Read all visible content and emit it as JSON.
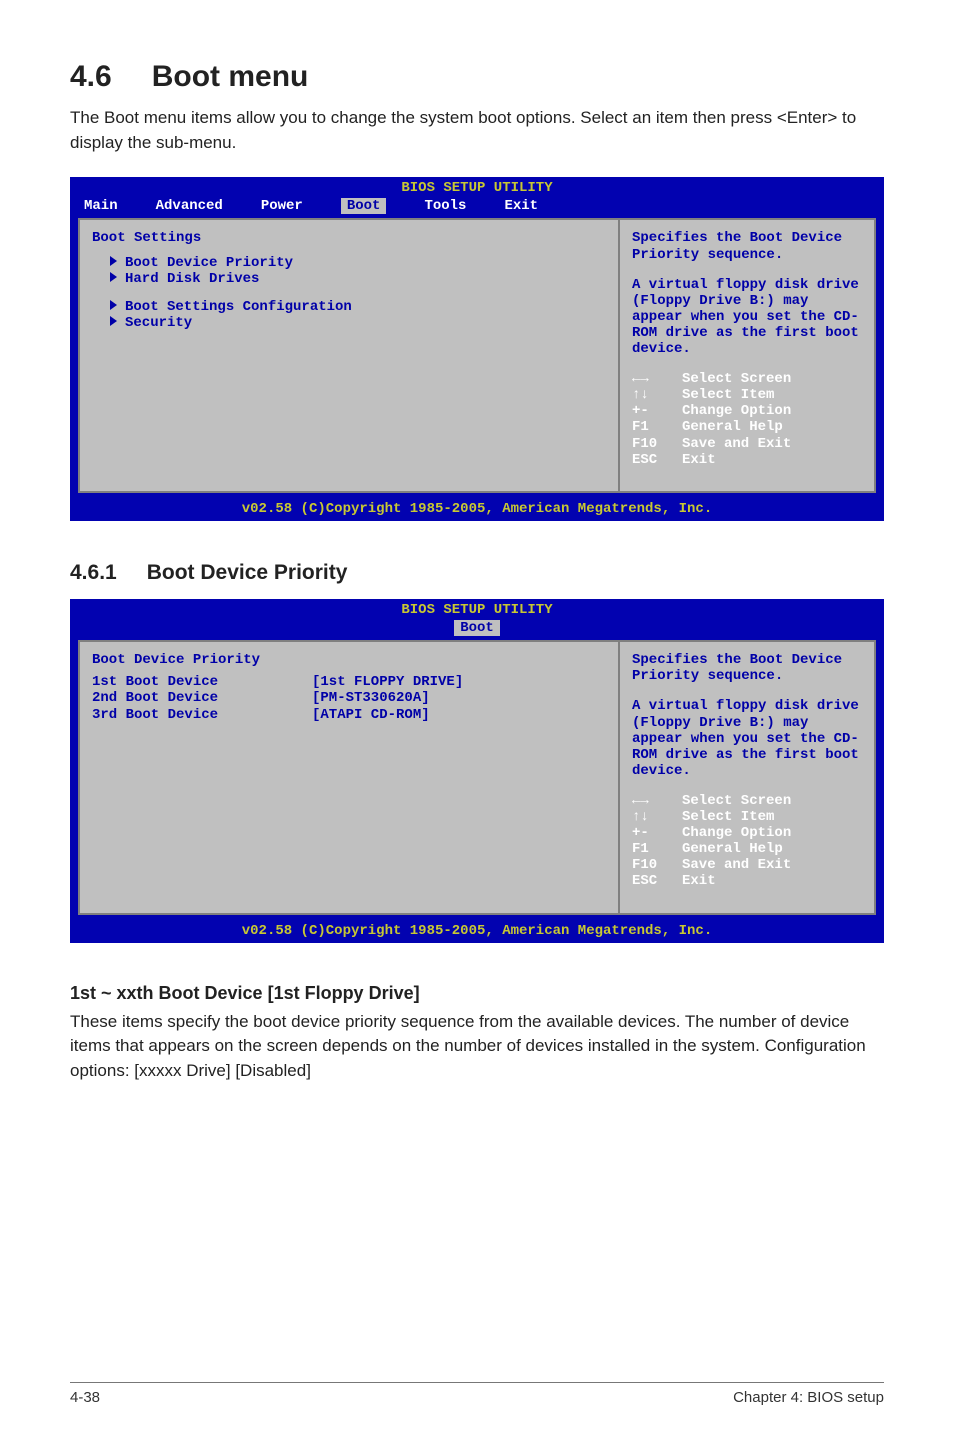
{
  "section": {
    "number": "4.6",
    "title": "Boot menu",
    "intro": "The Boot menu items allow you to change the system boot options. Select an item then press <Enter> to display the sub-menu."
  },
  "bios1": {
    "titlebar": "BIOS SETUP UTILITY",
    "menu": {
      "main": "Main",
      "advanced": "Advanced",
      "power": "Power",
      "boot": "Boot",
      "tools": "Tools",
      "exit": "Exit"
    },
    "left": {
      "heading": "Boot Settings",
      "items": [
        "Boot Device Priority",
        "Hard Disk Drives",
        "Boot Settings Configuration",
        "Security"
      ]
    },
    "right": {
      "desc1": "Specifies the Boot Device Priority sequence.",
      "desc2": "A virtual floppy disk drive (Floppy Drive B:) may appear when you set the CD-ROM drive as the first boot device.",
      "nav": {
        "lr": {
          "key": "←→",
          "label": "Select Screen"
        },
        "ud": {
          "key": "↑↓",
          "label": "Select Item"
        },
        "pm": {
          "key": "+-",
          "label": "Change Option"
        },
        "f1": {
          "key": "F1",
          "label": "General Help"
        },
        "f10": {
          "key": "F10",
          "label": "Save and Exit"
        },
        "esc": {
          "key": "ESC",
          "label": "Exit"
        }
      }
    },
    "footer": "v02.58 (C)Copyright 1985-2005, American Megatrends, Inc."
  },
  "subsection": {
    "number": "4.6.1",
    "title": "Boot Device Priority"
  },
  "bios2": {
    "titlebar": "BIOS SETUP UTILITY",
    "menu": {
      "boot": "Boot"
    },
    "left": {
      "heading": "Boot Device Priority",
      "devices": [
        {
          "label": "1st Boot Device",
          "value": "[1st FLOPPY DRIVE]"
        },
        {
          "label": "2nd Boot Device",
          "value": "[PM-ST330620A]"
        },
        {
          "label": "3rd Boot Device",
          "value": "[ATAPI CD-ROM]"
        }
      ]
    },
    "right": {
      "desc1": "Specifies the Boot Device Priority sequence.",
      "desc2": "A virtual floppy disk drive (Floppy Drive B:) may appear when you set the CD-ROM drive as the first boot device.",
      "nav": {
        "lr": {
          "key": "←→",
          "label": "Select Screen"
        },
        "ud": {
          "key": "↑↓",
          "label": "Select Item"
        },
        "pm": {
          "key": "+-",
          "label": "Change Option"
        },
        "f1": {
          "key": "F1",
          "label": "General Help"
        },
        "f10": {
          "key": "F10",
          "label": "Save and Exit"
        },
        "esc": {
          "key": "ESC",
          "label": "Exit"
        }
      }
    },
    "footer": "v02.58 (C)Copyright 1985-2005, American Megatrends, Inc."
  },
  "item": {
    "heading": "1st ~ xxth Boot Device [1st Floppy Drive]",
    "body": "These items specify the boot device priority sequence from the available devices. The number of device items that appears on the screen depends on the number of devices installed in the system. Configuration options: [xxxxx Drive] [Disabled]"
  },
  "footer": {
    "left": "4-38",
    "right": "Chapter 4: BIOS setup"
  }
}
